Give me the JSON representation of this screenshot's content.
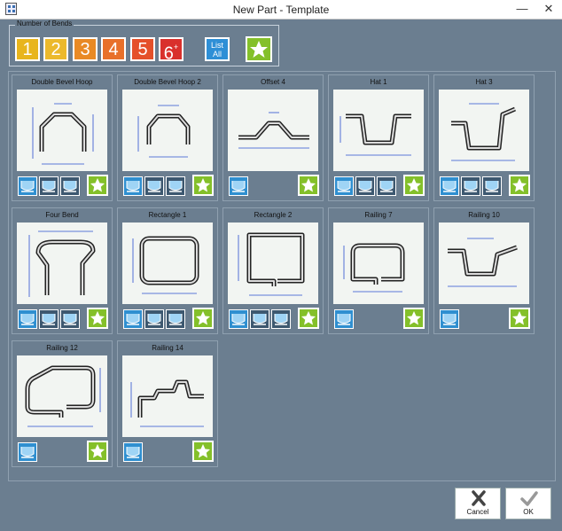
{
  "window": {
    "title": "New Part - Template"
  },
  "bends": {
    "legend": "Number of Bends",
    "buttons": [
      {
        "label": "1",
        "color": "#e8b51c"
      },
      {
        "label": "2",
        "color": "#ecb92c"
      },
      {
        "label": "3",
        "color": "#e98a25"
      },
      {
        "label": "4",
        "color": "#e8702a"
      },
      {
        "label": "5",
        "color": "#e5502a"
      },
      {
        "label": "6",
        "sup": "+",
        "color": "#d9302c"
      }
    ],
    "list_all_line1": "List",
    "list_all_line2": "All"
  },
  "templates": [
    {
      "name": "Double Bevel Hoop",
      "icons": [
        "blue",
        "dark",
        "dark"
      ]
    },
    {
      "name": "Double Bevel Hoop 2",
      "icons": [
        "blue",
        "dark",
        "dark"
      ]
    },
    {
      "name": "Offset 4",
      "icons": [
        "blue"
      ]
    },
    {
      "name": "Hat 1",
      "icons": [
        "blue",
        "dark",
        "dark"
      ]
    },
    {
      "name": "Hat 3",
      "icons": [
        "blue",
        "dark",
        "dark"
      ]
    },
    {
      "name": "Four Bend",
      "icons": [
        "blue",
        "dark",
        "dark"
      ]
    },
    {
      "name": "Rectangle 1",
      "icons": [
        "blue",
        "dark",
        "dark"
      ]
    },
    {
      "name": "Rectangle 2",
      "icons": [
        "blue",
        "dark",
        "dark"
      ]
    },
    {
      "name": "Railing 7",
      "icons": [
        "blue"
      ]
    },
    {
      "name": "Railing 10",
      "icons": [
        "blue"
      ]
    },
    {
      "name": "Railing 12",
      "icons": [
        "blue"
      ]
    },
    {
      "name": "Railing 14",
      "icons": [
        "blue"
      ]
    }
  ],
  "footer": {
    "cancel_label": "Cancel",
    "ok_label": "OK"
  },
  "colors": {
    "background": "#6b7e90",
    "star_green": "#84c02a",
    "icon_blue": "#2f8fd0"
  }
}
